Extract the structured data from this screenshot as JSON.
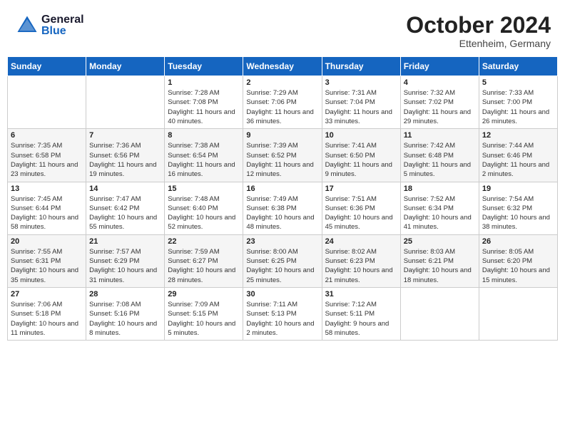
{
  "header": {
    "logo_general": "General",
    "logo_blue": "Blue",
    "month": "October 2024",
    "location": "Ettenheim, Germany"
  },
  "days_of_week": [
    "Sunday",
    "Monday",
    "Tuesday",
    "Wednesday",
    "Thursday",
    "Friday",
    "Saturday"
  ],
  "weeks": [
    [
      {
        "day": "",
        "info": ""
      },
      {
        "day": "",
        "info": ""
      },
      {
        "day": "1",
        "info": "Sunrise: 7:28 AM\nSunset: 7:08 PM\nDaylight: 11 hours and 40 minutes."
      },
      {
        "day": "2",
        "info": "Sunrise: 7:29 AM\nSunset: 7:06 PM\nDaylight: 11 hours and 36 minutes."
      },
      {
        "day": "3",
        "info": "Sunrise: 7:31 AM\nSunset: 7:04 PM\nDaylight: 11 hours and 33 minutes."
      },
      {
        "day": "4",
        "info": "Sunrise: 7:32 AM\nSunset: 7:02 PM\nDaylight: 11 hours and 29 minutes."
      },
      {
        "day": "5",
        "info": "Sunrise: 7:33 AM\nSunset: 7:00 PM\nDaylight: 11 hours and 26 minutes."
      }
    ],
    [
      {
        "day": "6",
        "info": "Sunrise: 7:35 AM\nSunset: 6:58 PM\nDaylight: 11 hours and 23 minutes."
      },
      {
        "day": "7",
        "info": "Sunrise: 7:36 AM\nSunset: 6:56 PM\nDaylight: 11 hours and 19 minutes."
      },
      {
        "day": "8",
        "info": "Sunrise: 7:38 AM\nSunset: 6:54 PM\nDaylight: 11 hours and 16 minutes."
      },
      {
        "day": "9",
        "info": "Sunrise: 7:39 AM\nSunset: 6:52 PM\nDaylight: 11 hours and 12 minutes."
      },
      {
        "day": "10",
        "info": "Sunrise: 7:41 AM\nSunset: 6:50 PM\nDaylight: 11 hours and 9 minutes."
      },
      {
        "day": "11",
        "info": "Sunrise: 7:42 AM\nSunset: 6:48 PM\nDaylight: 11 hours and 5 minutes."
      },
      {
        "day": "12",
        "info": "Sunrise: 7:44 AM\nSunset: 6:46 PM\nDaylight: 11 hours and 2 minutes."
      }
    ],
    [
      {
        "day": "13",
        "info": "Sunrise: 7:45 AM\nSunset: 6:44 PM\nDaylight: 10 hours and 58 minutes."
      },
      {
        "day": "14",
        "info": "Sunrise: 7:47 AM\nSunset: 6:42 PM\nDaylight: 10 hours and 55 minutes."
      },
      {
        "day": "15",
        "info": "Sunrise: 7:48 AM\nSunset: 6:40 PM\nDaylight: 10 hours and 52 minutes."
      },
      {
        "day": "16",
        "info": "Sunrise: 7:49 AM\nSunset: 6:38 PM\nDaylight: 10 hours and 48 minutes."
      },
      {
        "day": "17",
        "info": "Sunrise: 7:51 AM\nSunset: 6:36 PM\nDaylight: 10 hours and 45 minutes."
      },
      {
        "day": "18",
        "info": "Sunrise: 7:52 AM\nSunset: 6:34 PM\nDaylight: 10 hours and 41 minutes."
      },
      {
        "day": "19",
        "info": "Sunrise: 7:54 AM\nSunset: 6:32 PM\nDaylight: 10 hours and 38 minutes."
      }
    ],
    [
      {
        "day": "20",
        "info": "Sunrise: 7:55 AM\nSunset: 6:31 PM\nDaylight: 10 hours and 35 minutes."
      },
      {
        "day": "21",
        "info": "Sunrise: 7:57 AM\nSunset: 6:29 PM\nDaylight: 10 hours and 31 minutes."
      },
      {
        "day": "22",
        "info": "Sunrise: 7:59 AM\nSunset: 6:27 PM\nDaylight: 10 hours and 28 minutes."
      },
      {
        "day": "23",
        "info": "Sunrise: 8:00 AM\nSunset: 6:25 PM\nDaylight: 10 hours and 25 minutes."
      },
      {
        "day": "24",
        "info": "Sunrise: 8:02 AM\nSunset: 6:23 PM\nDaylight: 10 hours and 21 minutes."
      },
      {
        "day": "25",
        "info": "Sunrise: 8:03 AM\nSunset: 6:21 PM\nDaylight: 10 hours and 18 minutes."
      },
      {
        "day": "26",
        "info": "Sunrise: 8:05 AM\nSunset: 6:20 PM\nDaylight: 10 hours and 15 minutes."
      }
    ],
    [
      {
        "day": "27",
        "info": "Sunrise: 7:06 AM\nSunset: 5:18 PM\nDaylight: 10 hours and 11 minutes."
      },
      {
        "day": "28",
        "info": "Sunrise: 7:08 AM\nSunset: 5:16 PM\nDaylight: 10 hours and 8 minutes."
      },
      {
        "day": "29",
        "info": "Sunrise: 7:09 AM\nSunset: 5:15 PM\nDaylight: 10 hours and 5 minutes."
      },
      {
        "day": "30",
        "info": "Sunrise: 7:11 AM\nSunset: 5:13 PM\nDaylight: 10 hours and 2 minutes."
      },
      {
        "day": "31",
        "info": "Sunrise: 7:12 AM\nSunset: 5:11 PM\nDaylight: 9 hours and 58 minutes."
      },
      {
        "day": "",
        "info": ""
      },
      {
        "day": "",
        "info": ""
      }
    ]
  ]
}
